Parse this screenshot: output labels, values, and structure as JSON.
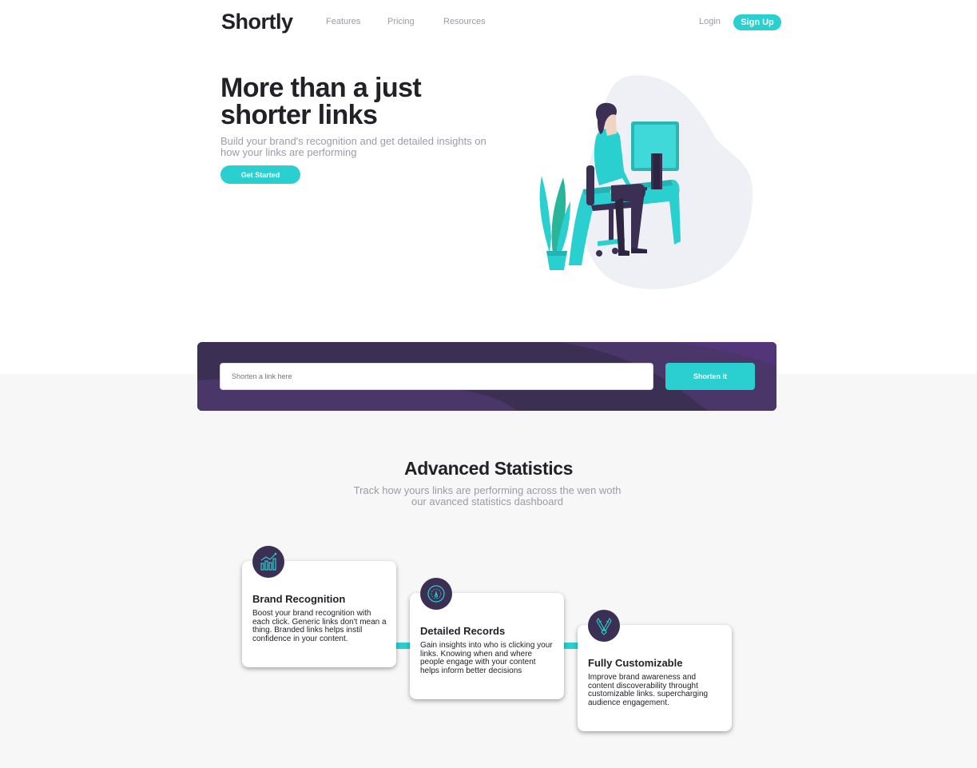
{
  "nav": {
    "logo": "Shortly",
    "links": [
      "Features",
      "Pricing",
      "Resources"
    ],
    "login": "Login",
    "signup": "Sign Up"
  },
  "hero": {
    "title": "More than a just shorter links",
    "subtitle": "Build your brand's recognition and get detailed insights on how your links are performing",
    "cta": "Get Started"
  },
  "shorten": {
    "placeholder": "Shorten a link here",
    "button": "Shorten it"
  },
  "stats": {
    "title": "Advanced Statistics",
    "subtitle": "Track how yours links are performing across the wen woth our avanced statistics dashboard",
    "cards": [
      {
        "icon": "chart-icon",
        "title": "Brand Recognition",
        "text": "Boost your brand recognition with each click. Generic links don't mean a thing. Branded links helps instil confidence in your content."
      },
      {
        "icon": "gauge-icon",
        "title": "Detailed Records",
        "text": "Gain insights into who is clicking your links. Knowing when and where people engage with your content helps inform better decisions"
      },
      {
        "icon": "brush-icon",
        "title": "Fully Customizable",
        "text": "Improve brand awareness and content discoverability throught customizable links. supercharging audience engagement."
      }
    ]
  },
  "colors": {
    "cyan": "#2acfcf",
    "dark_violet": "#3b3054",
    "grey": "#9e9aa7",
    "very_dark": "#232127"
  }
}
